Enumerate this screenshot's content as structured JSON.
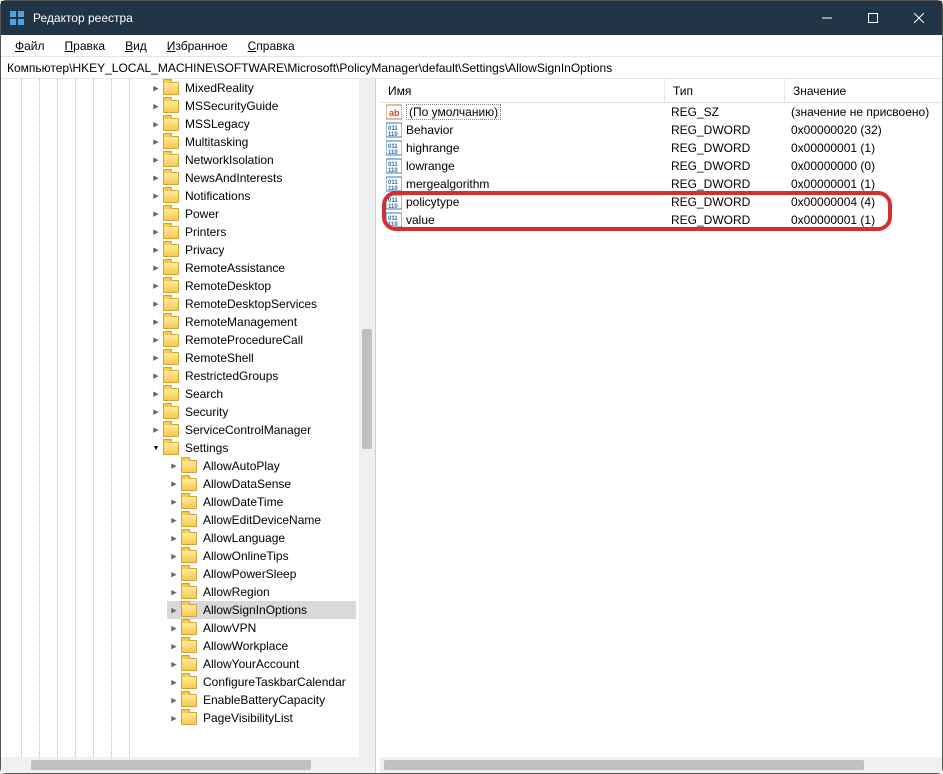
{
  "window": {
    "title": "Редактор реестра"
  },
  "menu": {
    "file": "Файл",
    "edit": "Правка",
    "view": "Вид",
    "favorites": "Избранное",
    "help": "Справка"
  },
  "address": "Компьютер\\HKEY_LOCAL_MACHINE\\SOFTWARE\\Microsoft\\PolicyManager\\default\\Settings\\AllowSignInOptions",
  "columns": {
    "name": "Имя",
    "type": "Тип",
    "data": "Значение"
  },
  "tree_level1": [
    "MixedReality",
    "MSSecurityGuide",
    "MSSLegacy",
    "Multitasking",
    "NetworkIsolation",
    "NewsAndInterests",
    "Notifications",
    "Power",
    "Printers",
    "Privacy",
    "RemoteAssistance",
    "RemoteDesktop",
    "RemoteDesktopServices",
    "RemoteManagement",
    "RemoteProcedureCall",
    "RemoteShell",
    "RestrictedGroups",
    "Search",
    "Security",
    "ServiceControlManager"
  ],
  "settings_label": "Settings",
  "tree_level2": [
    "AllowAutoPlay",
    "AllowDataSense",
    "AllowDateTime",
    "AllowEditDeviceName",
    "AllowLanguage",
    "AllowOnlineTips",
    "AllowPowerSleep",
    "AllowRegion",
    "AllowSignInOptions",
    "AllowVPN",
    "AllowWorkplace",
    "AllowYourAccount",
    "ConfigureTaskbarCalendar",
    "EnableBatteryCapacity",
    "PageVisibilityList"
  ],
  "selected_child": "AllowSignInOptions",
  "values": [
    {
      "name": "(По умолчанию)",
      "type": "REG_SZ",
      "data": "(значение не присвоено)",
      "icon": "sz",
      "selected": true
    },
    {
      "name": "Behavior",
      "type": "REG_DWORD",
      "data": "0x00000020 (32)",
      "icon": "bin"
    },
    {
      "name": "highrange",
      "type": "REG_DWORD",
      "data": "0x00000001 (1)",
      "icon": "bin"
    },
    {
      "name": "lowrange",
      "type": "REG_DWORD",
      "data": "0x00000000 (0)",
      "icon": "bin"
    },
    {
      "name": "mergealgorithm",
      "type": "REG_DWORD",
      "data": "0x00000001 (1)",
      "icon": "bin"
    },
    {
      "name": "policytype",
      "type": "REG_DWORD",
      "data": "0x00000004 (4)",
      "icon": "bin"
    },
    {
      "name": "value",
      "type": "REG_DWORD",
      "data": "0x00000001 (1)",
      "icon": "bin"
    }
  ]
}
